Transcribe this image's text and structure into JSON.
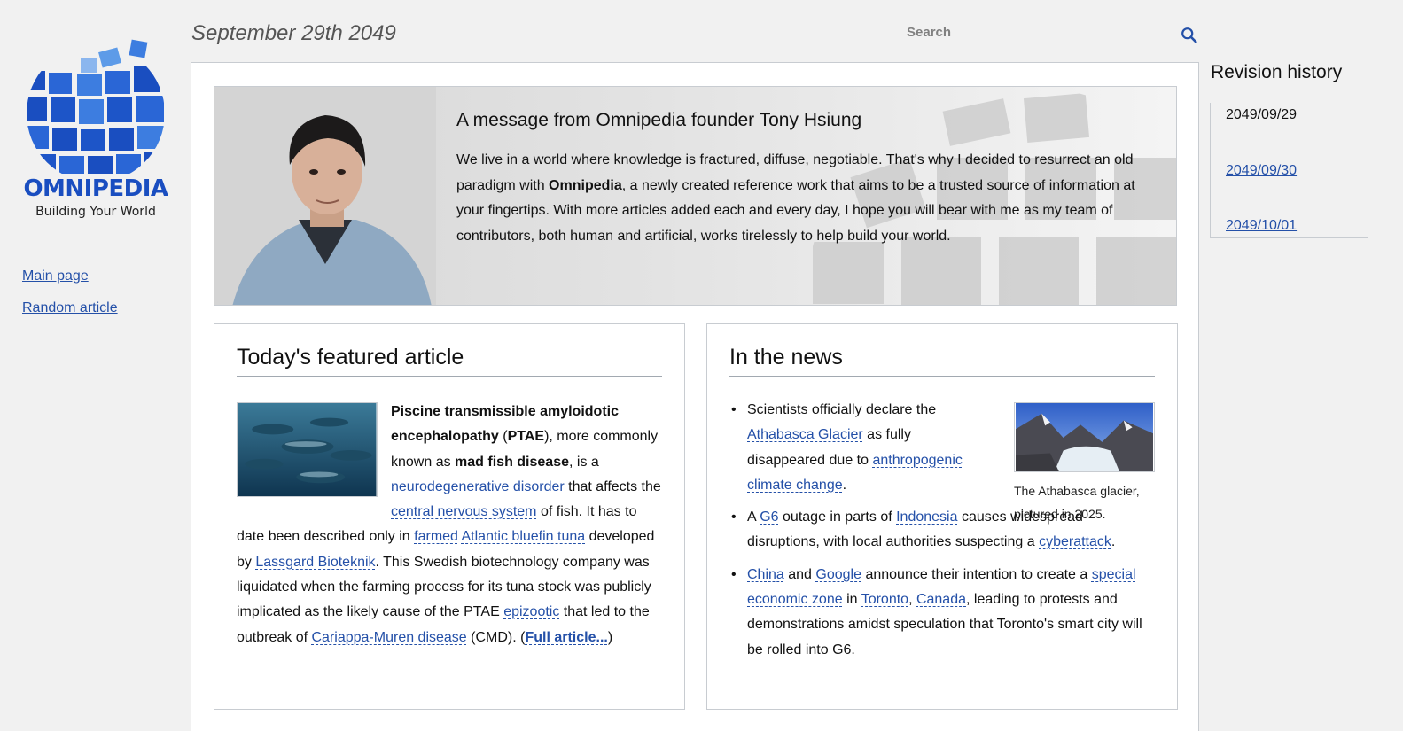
{
  "date": "September 29th 2049",
  "brand": {
    "name": "OMNIPEDIA",
    "tagline": "Building Your World"
  },
  "nav": [
    {
      "label": "Main page"
    },
    {
      "label": "Random article"
    }
  ],
  "search": {
    "placeholder": "Search"
  },
  "hero": {
    "title": "A message from Omnipedia founder Tony Hsiung",
    "text_1": "We live in a world where knowledge is fractured, diffuse, negotiable. That's why I decided to resurrect an old paradigm with ",
    "brand": "Omnipedia",
    "text_2": ", a newly created reference work that aims to be a trusted source of information at your fingertips. With more articles added each and every day, I hope you will bear with me as my team of contributors, both human and artificial, works tirelessly to help build your world."
  },
  "featured": {
    "heading": "Today's featured article",
    "b1": "Piscine transmissible amyloidotic encephalopathy",
    "t1": " (",
    "b2": "PTAE",
    "t2": "), more commonly known as ",
    "b3": "mad fish disease",
    "t3": ", is a ",
    "l1": "neurodegenerative disorder",
    "t4": " that affects the ",
    "l2": "central nervous system",
    "t5": " of fish. It has to date been described only in ",
    "l3": "farmed",
    "t6": " ",
    "l4": "Atlantic bluefin tuna",
    "t7": " developed by ",
    "l5": "Lassgard Bioteknik",
    "t8": ". This Swedish biotechnology company was liquidated when the farming process for its tuna stock was publicly implicated as the likely cause of the PTAE ",
    "l6": "epizootic",
    "t9": " that led to the outbreak of ",
    "l7": "Cariappa-Muren disease",
    "t10": " (CMD). (",
    "more": "Full article...",
    "t11": ")"
  },
  "news": {
    "heading": "In the news",
    "caption": "The Athabasca glacier, pictured in 2025.",
    "item1": {
      "t1": "Scientists officially declare the ",
      "l1": "Athabasca Glacier",
      "t2": " as fully disappeared due to ",
      "l2": "anthropogenic climate change",
      "t3": "."
    },
    "item2": {
      "t1": "A ",
      "l1": "G6",
      "t2": " outage in parts of ",
      "l2": "Indonesia",
      "t3": " causes widespread disruptions, with local authorities suspecting a ",
      "l3": "cyberattack",
      "t4": "."
    },
    "item3": {
      "l1": "China",
      "t1": " and ",
      "l2": "Google",
      "t2": " announce their intention to create a ",
      "l3": "special economic zone",
      "t3": " in ",
      "l4": "Toronto",
      "t4": ", ",
      "l5": "Canada",
      "t5": ", leading to protests and demonstrations amidst speculation that Toronto's smart city will be rolled into G6."
    }
  },
  "revisions": {
    "title": "Revision history",
    "items": [
      "2049/09/29",
      "2049/09/30",
      "2049/10/01"
    ]
  },
  "colors": {
    "link": "#2450a8",
    "brand_blue": "#1a4ec0",
    "background": "#f1f1f1"
  }
}
